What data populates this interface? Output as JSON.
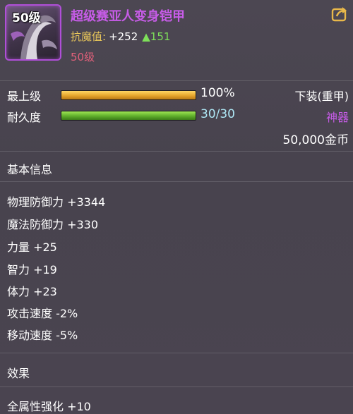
{
  "item": {
    "level_badge": "50级",
    "name": "超级赛亚人变身铠甲",
    "stat_label": "抗魔值:",
    "stat_value": "+252",
    "stat_increase": "▲151",
    "required_level": "50级"
  },
  "status": {
    "grade_label": "最上级",
    "grade_value": "100%",
    "grade_fraction": 1.0,
    "durability_label": "耐久度",
    "durability_value": "30/30",
    "durability_fraction": 1.0,
    "slot": "下装(重甲)",
    "rarity": "神器",
    "price": "50,000金币"
  },
  "basic_info": {
    "title": "基本信息",
    "attributes": [
      "物理防御力 +3344",
      "魔法防御力 +330",
      "力量 +25",
      "智力 +19",
      "体力 +23",
      "攻击速度 -2%",
      "移动速度 -5%"
    ]
  },
  "effects": {
    "title": "效果",
    "items": [
      "全属性强化 +10"
    ]
  },
  "colors": {
    "rarity": "#c75ce8",
    "stat_label": "#e8c65a",
    "increase": "#7ee05a",
    "required_level": "#e0607a",
    "bar_gold": "#e6a52c",
    "bar_green": "#5fae2b"
  },
  "icons": {
    "share": "share-icon",
    "item": "armor-item-icon"
  }
}
